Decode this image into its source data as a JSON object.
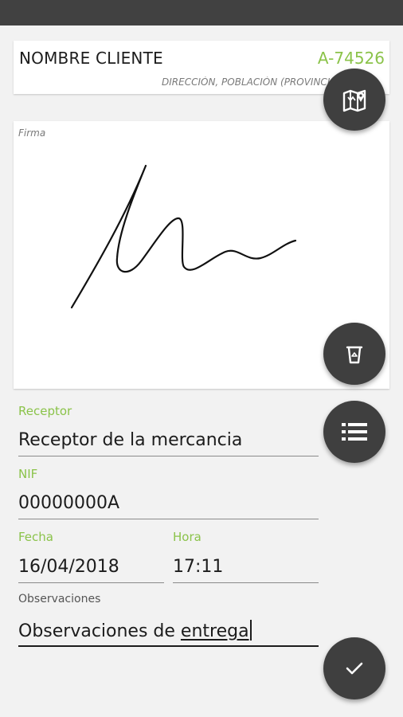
{
  "client": {
    "name": "NOMBRE CLIENTE",
    "code": "A-74526",
    "address": "DIRECCIÓN, POBLACIÓN (PROVINCIA)"
  },
  "signature": {
    "label": "Firma"
  },
  "form": {
    "receptor": {
      "label": "Receptor",
      "value": "Receptor de la mercancia"
    },
    "nif": {
      "label": "NIF",
      "value": "00000000A"
    },
    "fecha": {
      "label": "Fecha",
      "value": "16/04/2018"
    },
    "hora": {
      "label": "Hora",
      "value": "17:11"
    },
    "observaciones": {
      "label": "Observaciones",
      "value_start": "Observaciones de ",
      "value_underlined": "entrega"
    }
  },
  "icons": {
    "map": "map-icon",
    "clear": "trash-icon",
    "list": "list-icon",
    "confirm": "check-icon"
  },
  "colors": {
    "accent": "#8bc34a",
    "fab": "#3f3f3f",
    "statusbar": "#414141"
  }
}
